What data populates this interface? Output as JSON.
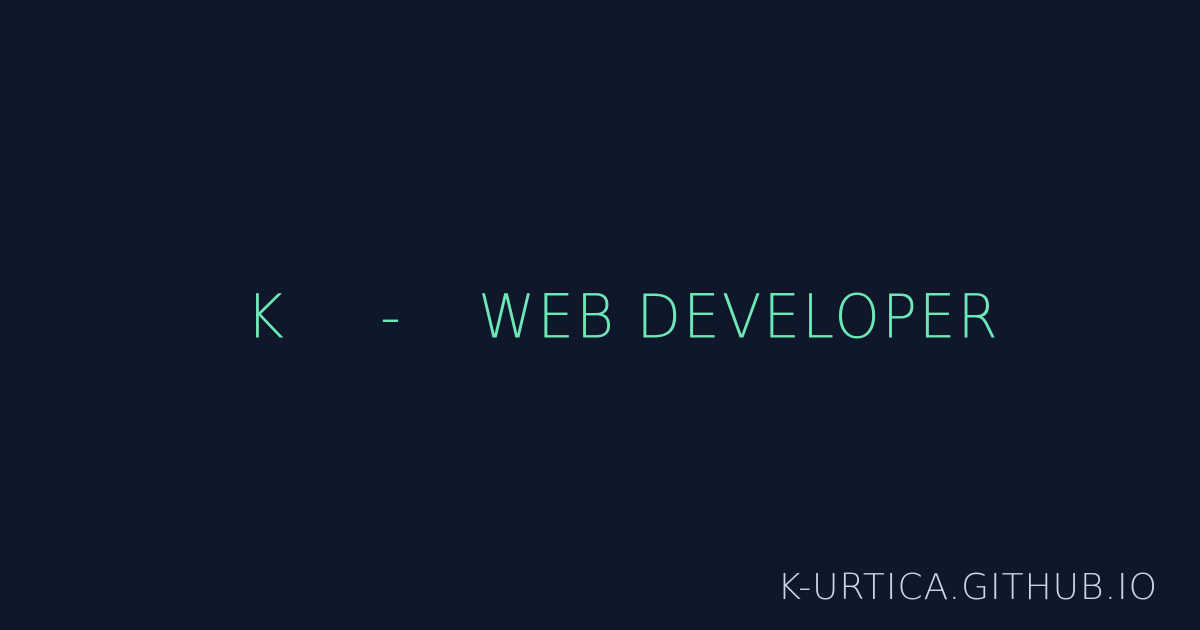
{
  "headline": {
    "initial": "K",
    "separator": "-",
    "role": "WEB DEVELOPER"
  },
  "domain": "K-URTICA.GITHUB.IO",
  "colors": {
    "background": "#0f172a",
    "accent": "#6ee7b7",
    "muted_text": "#cbd5e1"
  }
}
